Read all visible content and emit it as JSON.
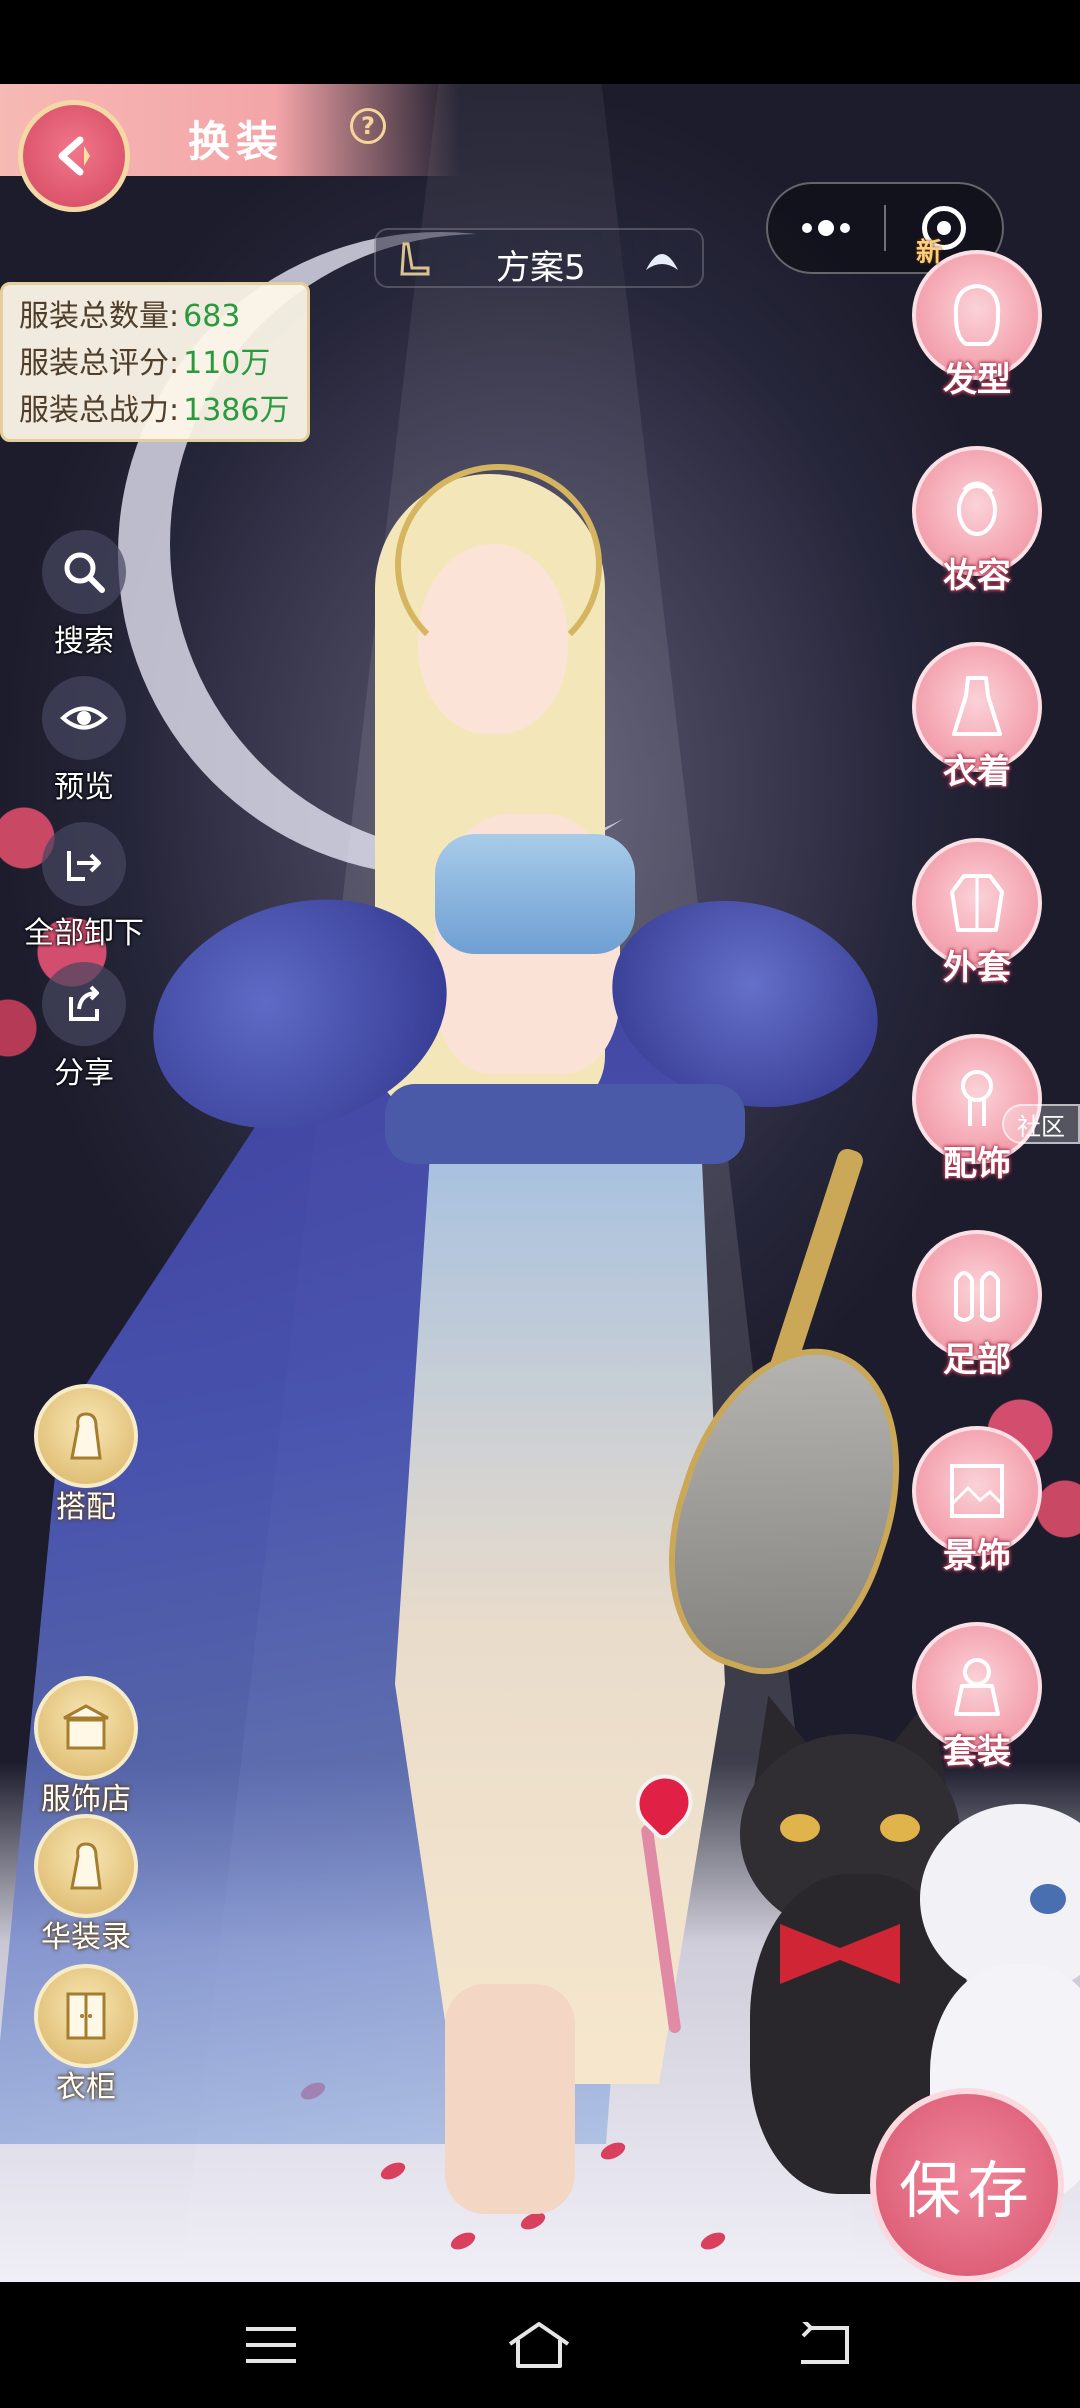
{
  "header": {
    "title": "换装",
    "help": "?"
  },
  "scheme": {
    "label": "方案5"
  },
  "stats": [
    {
      "label": "服装总数量:",
      "value": "683"
    },
    {
      "label": "服装总评分:",
      "value": "110万"
    },
    {
      "label": "服装总战力:",
      "value": "1386万"
    }
  ],
  "left_tools": [
    {
      "label": "搜索",
      "icon": "search-icon"
    },
    {
      "label": "预览",
      "icon": "eye-icon"
    },
    {
      "label": "全部卸下",
      "icon": "remove-all-icon"
    },
    {
      "label": "分享",
      "icon": "share-icon"
    }
  ],
  "left_gold_tools": [
    {
      "label": "搭配",
      "icon": "match-icon"
    },
    {
      "label": "服饰店",
      "icon": "shop-icon"
    },
    {
      "label": "华装录",
      "icon": "catalog-icon"
    },
    {
      "label": "衣柜",
      "icon": "wardrobe-icon"
    }
  ],
  "categories": [
    {
      "label": "发型",
      "icon": "hairstyle-icon"
    },
    {
      "label": "妆容",
      "icon": "makeup-icon"
    },
    {
      "label": "衣着",
      "icon": "dress-icon"
    },
    {
      "label": "外套",
      "icon": "coat-icon"
    },
    {
      "label": "配饰",
      "icon": "accessory-icon"
    },
    {
      "label": "足部",
      "icon": "shoes-icon"
    },
    {
      "label": "景饰",
      "icon": "scenery-icon"
    },
    {
      "label": "套装",
      "icon": "suit-icon"
    }
  ],
  "badges": {
    "new": "新"
  },
  "community": {
    "label": "社区"
  },
  "save": {
    "label": "保存"
  },
  "colors": {
    "accent_pink": "#e86c84",
    "gold": "#d9b363",
    "value_green": "#2a9a3e"
  }
}
